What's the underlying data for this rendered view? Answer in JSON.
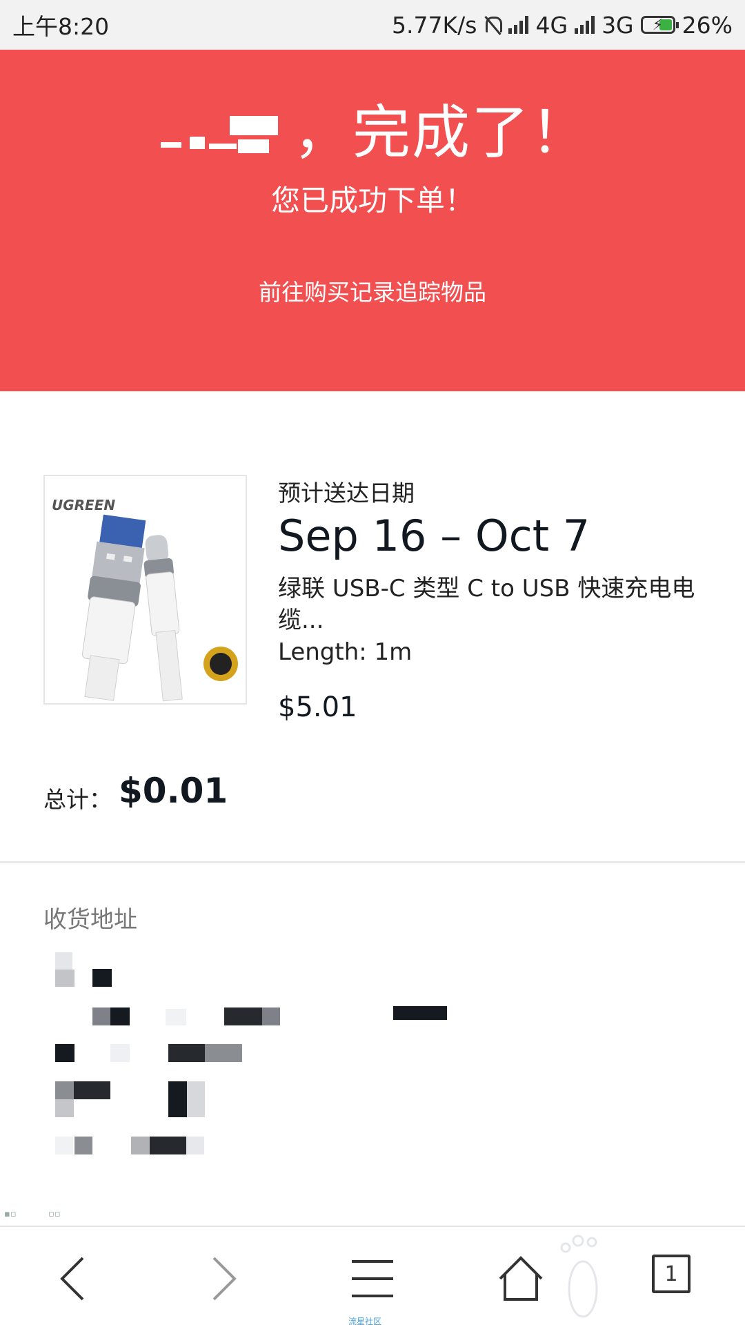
{
  "status_bar": {
    "time": "上午8:20",
    "net_speed": "5.77K/s",
    "network1": "4G",
    "network2": "3G",
    "battery": "26%"
  },
  "hero": {
    "title": "，完成了！",
    "subtitle": "您已成功下单！",
    "link": "前往购买记录追踪物品",
    "bg_color": "#f24f51"
  },
  "order": {
    "thumbnail_brand": "UGREEN",
    "estimate_label": "预计送达日期",
    "estimate_dates": "Sep 16 – Oct 7",
    "item_title": "绿联 USB-C 类型 C to USB 快速充电电缆...",
    "item_variant": "Length: 1m",
    "item_price": "$5.01",
    "total_label": "总计：",
    "total_value": "$0.01"
  },
  "address": {
    "label": "收货地址"
  },
  "bottom_nav": {
    "caption": "流星社区",
    "tab_count": "1",
    "icons": [
      "back-icon",
      "forward-icon",
      "menu-icon",
      "home-icon",
      "tabs-icon"
    ]
  }
}
